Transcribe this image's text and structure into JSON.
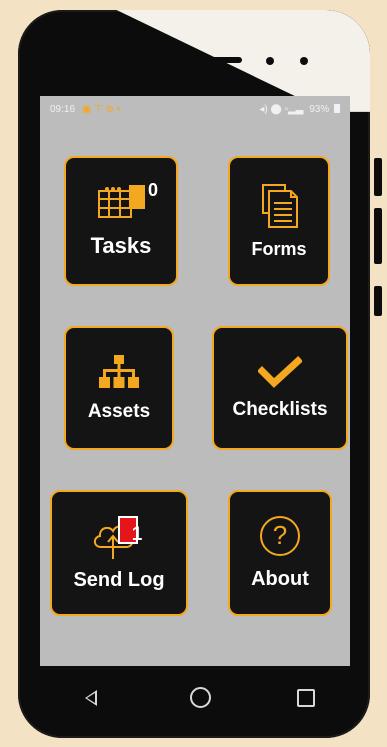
{
  "status_bar": {
    "time": "09:16",
    "left_icons": "▣ ⊤ ⊚ •",
    "right_icons": "◂) ⬤ ▫▂▃",
    "battery": "93%"
  },
  "tiles": {
    "tasks": {
      "label": "Tasks",
      "badge": "0"
    },
    "forms": {
      "label": "Forms"
    },
    "assets": {
      "label": "Assets"
    },
    "checklists": {
      "label": "Checklists"
    },
    "send_log": {
      "label": "Send Log",
      "badge": "1"
    },
    "about": {
      "label": "About",
      "icon_text": "?"
    }
  },
  "colors": {
    "accent": "#f3a81f",
    "tile_bg": "#141414",
    "screen_bg": "#bcbcbc",
    "badge_red": "#e5161b"
  },
  "navigation": {
    "back": "back-icon",
    "home": "home-icon",
    "recents": "recents-icon"
  }
}
